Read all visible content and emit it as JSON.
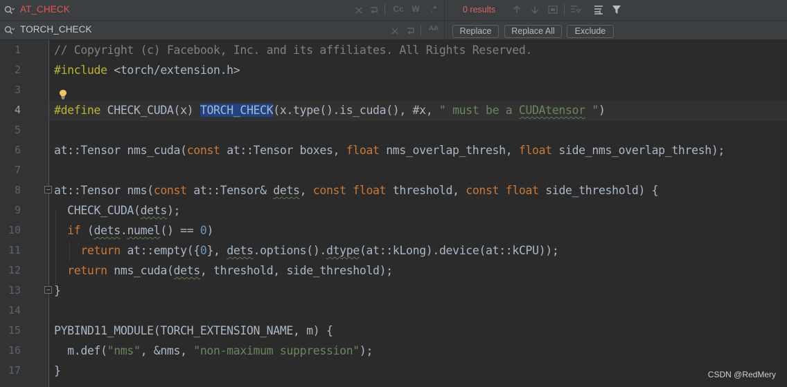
{
  "find": {
    "query": "AT_CHECK",
    "match_case_label": "Cc",
    "words_label": "W",
    "regex_label": ".*",
    "results": "0 results"
  },
  "replace": {
    "value": "TORCH_CHECK",
    "preserve_case_label": "A̶A",
    "replace_label": "Replace",
    "replace_all_label": "Replace All",
    "exclude_label": "Exclude"
  },
  "editor": {
    "current_line": 4,
    "line_numbers": [
      "1",
      "2",
      "3",
      "4",
      "5",
      "6",
      "7",
      "8",
      "9",
      "10",
      "11",
      "12",
      "13",
      "14",
      "15",
      "16",
      "17"
    ],
    "lines": [
      [
        {
          "t": "// Copyright (c) Facebook, Inc. and its affiliates. All Rights Reserved.",
          "c": "cm"
        }
      ],
      [
        {
          "t": "#include",
          "c": "pp"
        },
        {
          "t": " <torch/extension.h>",
          "c": ""
        }
      ],
      [],
      [
        {
          "t": "#define",
          "c": "pp"
        },
        {
          "t": " CHECK_CUDA(x) ",
          "c": ""
        },
        {
          "t": "TORCH_CHECK",
          "c": "hl"
        },
        {
          "t": "(x.type().is_cuda(), #x, ",
          "c": ""
        },
        {
          "t": "\" must be a ",
          "c": "st"
        },
        {
          "t": "CUDAtensor",
          "c": "st sq"
        },
        {
          "t": " \"",
          "c": "st"
        },
        {
          "t": ")",
          "c": ""
        }
      ],
      [],
      [
        {
          "t": "at::Tensor nms_cuda(",
          "c": ""
        },
        {
          "t": "const",
          "c": "kw"
        },
        {
          "t": " at::Tensor boxes, ",
          "c": ""
        },
        {
          "t": "float",
          "c": "kw"
        },
        {
          "t": " nms_overlap_thresh, ",
          "c": ""
        },
        {
          "t": "float",
          "c": "kw"
        },
        {
          "t": " side_nms_overlap_thresh);",
          "c": ""
        }
      ],
      [],
      [
        {
          "t": "at::Tensor nms(",
          "c": ""
        },
        {
          "t": "const",
          "c": "kw"
        },
        {
          "t": " at::Tensor& ",
          "c": ""
        },
        {
          "t": "dets",
          "c": "sq"
        },
        {
          "t": ", ",
          "c": ""
        },
        {
          "t": "const float",
          "c": "kw"
        },
        {
          "t": " threshold, ",
          "c": ""
        },
        {
          "t": "const float",
          "c": "kw"
        },
        {
          "t": " side_threshold) {",
          "c": ""
        }
      ],
      [
        {
          "t": "  CHECK_CUDA(",
          "c": ""
        },
        {
          "t": "dets",
          "c": "sq"
        },
        {
          "t": ");",
          "c": ""
        }
      ],
      [
        {
          "t": "  ",
          "c": ""
        },
        {
          "t": "if",
          "c": "kw"
        },
        {
          "t": " (",
          "c": ""
        },
        {
          "t": "dets",
          "c": "sq"
        },
        {
          "t": ".",
          "c": ""
        },
        {
          "t": "numel",
          "c": "sq"
        },
        {
          "t": "() == ",
          "c": ""
        },
        {
          "t": "0",
          "c": "nu"
        },
        {
          "t": ")",
          "c": ""
        }
      ],
      [
        {
          "t": "    ",
          "c": ""
        },
        {
          "t": "return",
          "c": "kw"
        },
        {
          "t": " at::empty({",
          "c": ""
        },
        {
          "t": "0",
          "c": "nu"
        },
        {
          "t": "}, ",
          "c": ""
        },
        {
          "t": "dets",
          "c": "sq"
        },
        {
          "t": ".options().",
          "c": ""
        },
        {
          "t": "dtype",
          "c": "sq"
        },
        {
          "t": "(at::kLong).device(at::kCPU));",
          "c": ""
        }
      ],
      [
        {
          "t": "  ",
          "c": ""
        },
        {
          "t": "return",
          "c": "kw"
        },
        {
          "t": " nms_cuda(",
          "c": ""
        },
        {
          "t": "dets",
          "c": "sq"
        },
        {
          "t": ", threshold, side_threshold);",
          "c": ""
        }
      ],
      [
        {
          "t": "}",
          "c": ""
        }
      ],
      [],
      [
        {
          "t": "PYBIND11_MODULE(TORCH_EXTENSION_NAME, m) {",
          "c": ""
        }
      ],
      [
        {
          "t": "  m.def(",
          "c": ""
        },
        {
          "t": "\"nms\"",
          "c": "st"
        },
        {
          "t": ", &nms, ",
          "c": ""
        },
        {
          "t": "\"non-maximum suppression\"",
          "c": "st"
        },
        {
          "t": ");",
          "c": ""
        }
      ],
      [
        {
          "t": "}",
          "c": ""
        }
      ]
    ]
  },
  "watermark": "CSDN @RedMery"
}
